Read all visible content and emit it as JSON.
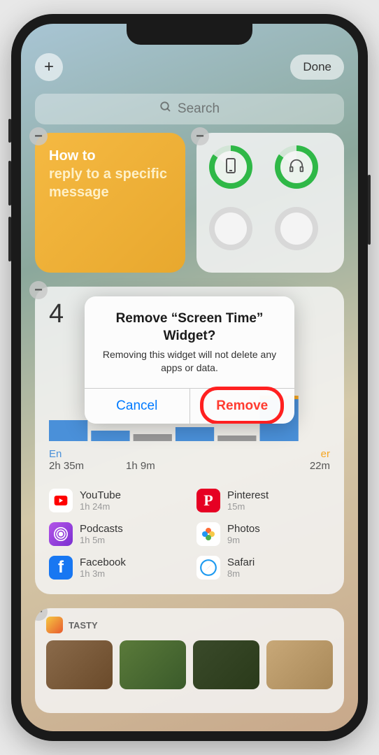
{
  "topbar": {
    "add_label": "+",
    "done_label": "Done"
  },
  "search": {
    "placeholder": "Search"
  },
  "notes_widget": {
    "line1": "How to",
    "line2": "reply to a specific message"
  },
  "screentime": {
    "big_number_prefix": "4",
    "categories": [
      {
        "name": "En",
        "time": "2h 35m"
      },
      {
        "name": "",
        "time": "1h 9m"
      },
      {
        "name": "er",
        "time": "22m"
      }
    ],
    "apps": [
      {
        "id": "youtube",
        "name": "YouTube",
        "time": "1h 24m",
        "bg": "#ffffff",
        "accent": "#ff0000"
      },
      {
        "id": "pinterest",
        "name": "Pinterest",
        "time": "15m",
        "bg": "#e60023",
        "accent": "#ffffff"
      },
      {
        "id": "podcasts",
        "name": "Podcasts",
        "time": "1h 5m",
        "bg": "linear-gradient(135deg,#b455e8,#7a2fd0)",
        "accent": "#ffffff"
      },
      {
        "id": "photos",
        "name": "Photos",
        "time": "9m",
        "bg": "#ffffff",
        "accent": "multi"
      },
      {
        "id": "facebook",
        "name": "Facebook",
        "time": "1h 3m",
        "bg": "#1877f2",
        "accent": "#ffffff"
      },
      {
        "id": "safari",
        "name": "Safari",
        "time": "8m",
        "bg": "#ffffff",
        "accent": "#1e9af0"
      }
    ]
  },
  "tasty": {
    "label": "TASTY"
  },
  "modal": {
    "title": "Remove “Screen Time” Widget?",
    "message": "Removing this widget will not delete any apps or data.",
    "cancel_label": "Cancel",
    "remove_label": "Remove"
  }
}
